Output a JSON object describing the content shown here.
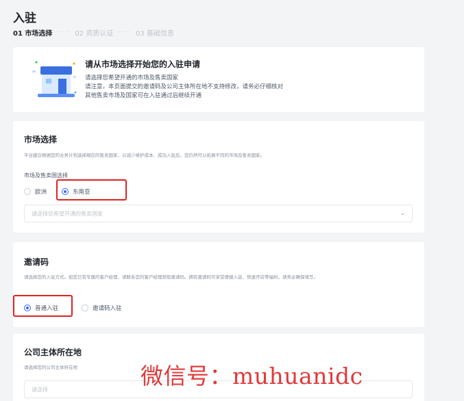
{
  "header": {
    "title": "入驻",
    "steps": [
      {
        "label": "01 市场选择",
        "active": true
      },
      {
        "label": "02 资质认证",
        "active": false
      },
      {
        "label": "03 基础信息",
        "active": false
      }
    ],
    "separator": "·····"
  },
  "banner": {
    "icon": "store-icon",
    "title": "请从市场选择开始您的入驻申请",
    "lines": [
      "请选择您希望开通的市场及售卖国家",
      "请注意，本页面提交的邀请码及公司主体所在地不支持修改，请务必仔细核对",
      "其他售卖市场及国家可在入驻通过后继续开通"
    ]
  },
  "market": {
    "title": "市场选择",
    "desc": "平台建议根据您的业务计划选择相应的售卖国家，以减少维护成本、成功入驻后，您仍然可以拓展不同的市场及售卖国家。",
    "field_label": "市场及售卖国选择",
    "options": [
      {
        "label": "欧洲",
        "checked": false
      },
      {
        "label": "东南亚",
        "checked": true
      }
    ],
    "select_placeholder": "请选择您希望开通的售卖国家",
    "chevron": "⌄"
  },
  "invite": {
    "title": "邀请码",
    "desc": "请选择您的入驻方式。如您已有专属的客户经理，请联系您的客户经理获取邀请码。拥有邀请码可享受便捷入驻、快速开店等福利，请务必确保填写。",
    "options": [
      {
        "label": "普通入驻",
        "checked": true
      },
      {
        "label": "邀请码入驻",
        "checked": false
      }
    ]
  },
  "company": {
    "title": "公司主体所在地",
    "desc": "请选择您的公司主体所在地",
    "select_placeholder": "请选择"
  },
  "watermark": "微信号：muhuanidc",
  "colors": {
    "accent": "#3366ff",
    "highlight": "#e02020",
    "watermark": "#e03a3a"
  }
}
